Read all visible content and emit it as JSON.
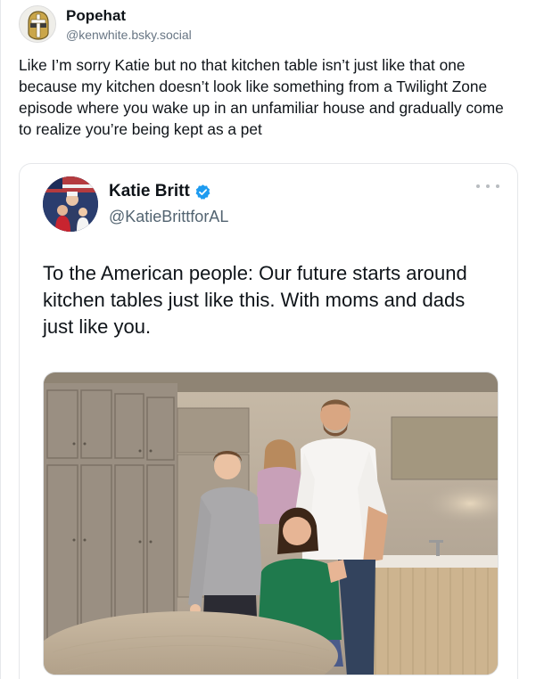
{
  "post": {
    "author_name": "Popehat",
    "author_handle": "@kenwhite.bsky.social",
    "avatar_icon": "popehat-helmet-icon",
    "text": "Like I’m sorry Katie but no that kitchen table isn’t just like that one because my kitchen doesn’t look like something from a Twilight Zone episode where you wake up in an unfamiliar house and gradually come to realize you’re being kept as a pet"
  },
  "quote": {
    "author_name": "Katie Britt",
    "author_handle": "@KatieBrittforAL",
    "verified_icon": "verified-badge-icon",
    "verified_color": "#1d9bf0",
    "more_icon": "more-options-icon",
    "text": "To the American people: Our future starts around kitchen tables just like this. With moms and dads just like you.",
    "media_icon": "family-kitchen-photo"
  }
}
